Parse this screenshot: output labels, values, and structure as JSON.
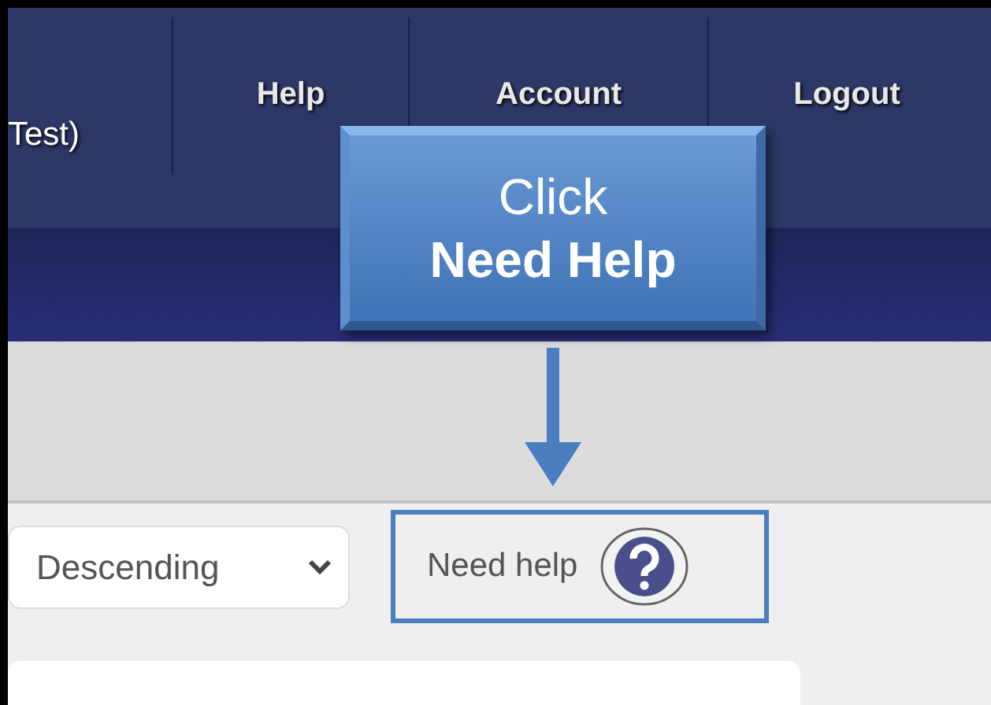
{
  "nav": {
    "user_fragment": "Test)",
    "items": [
      {
        "label": "Help"
      },
      {
        "label": "Account"
      },
      {
        "label": "Logout"
      }
    ]
  },
  "toolbar": {
    "sort": {
      "value": "Descending"
    },
    "help_link": {
      "label": "Need help",
      "highlighted": true
    }
  },
  "callout": {
    "line_1": "Click",
    "line_2": "Need Help"
  }
}
